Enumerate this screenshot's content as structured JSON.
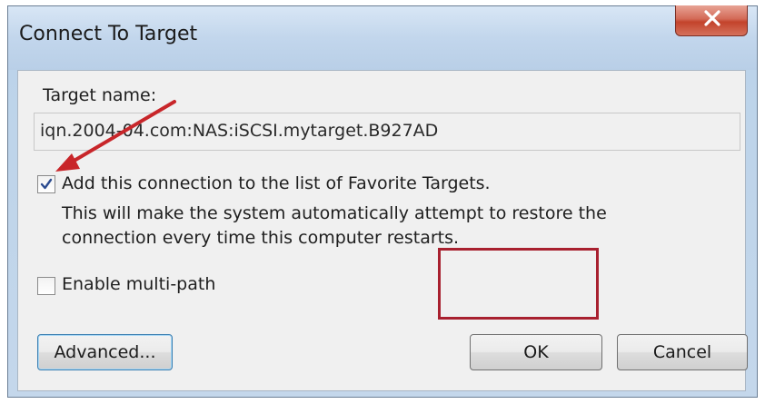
{
  "window": {
    "title": "Connect To Target"
  },
  "target": {
    "label": "Target name:",
    "value": "iqn.2004-04.com:NAS:iSCSI.mytarget.B927AD"
  },
  "favorites": {
    "checkbox_label": "Add this connection to the list of Favorite Targets.",
    "checked": true,
    "description_line1": "This will make the system automatically attempt to restore the",
    "description_line2": "connection every time this computer restarts."
  },
  "multipath": {
    "checkbox_label": "Enable multi-path",
    "checked": false
  },
  "buttons": {
    "advanced": "Advanced...",
    "ok": "OK",
    "cancel": "Cancel"
  },
  "colors": {
    "annotation_red": "#a8202f",
    "arrow_red": "#c8262a"
  }
}
